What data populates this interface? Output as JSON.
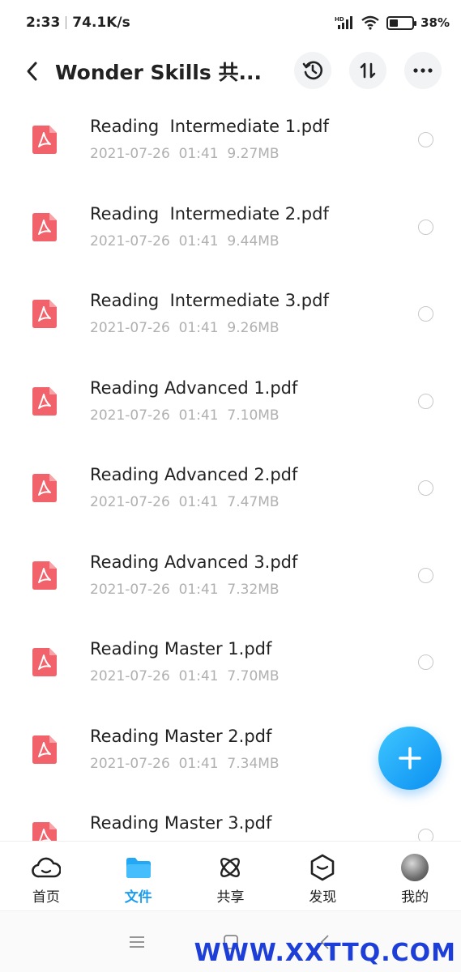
{
  "status_bar": {
    "time": "2:33",
    "net_speed": "74.1K/s",
    "battery_text": "38%",
    "battery_level": 0.38
  },
  "header": {
    "title": "Wonder Skills  共..."
  },
  "files": [
    {
      "name": "Reading  Intermediate 1.pdf",
      "meta": "2021-07-26  01:41  9.27MB"
    },
    {
      "name": "Reading  Intermediate 2.pdf",
      "meta": "2021-07-26  01:41  9.44MB"
    },
    {
      "name": "Reading  Intermediate 3.pdf",
      "meta": "2021-07-26  01:41  9.26MB"
    },
    {
      "name": "Reading Advanced 1.pdf",
      "meta": "2021-07-26  01:41  7.10MB"
    },
    {
      "name": "Reading Advanced 2.pdf",
      "meta": "2021-07-26  01:41  7.47MB"
    },
    {
      "name": "Reading Advanced 3.pdf",
      "meta": "2021-07-26  01:41  7.32MB"
    },
    {
      "name": "Reading Master 1.pdf",
      "meta": "2021-07-26  01:41  7.70MB"
    },
    {
      "name": "Reading Master 2.pdf",
      "meta": "2021-07-26  01:41  7.34MB"
    },
    {
      "name": "Reading Master 3.pdf",
      "meta": ""
    }
  ],
  "bottom_nav": {
    "items": [
      {
        "label": "首页",
        "icon": "cloud-icon"
      },
      {
        "label": "文件",
        "icon": "folder-icon"
      },
      {
        "label": "共享",
        "icon": "atom-icon"
      },
      {
        "label": "发现",
        "icon": "discover-icon"
      },
      {
        "label": "我的",
        "icon": "avatar"
      }
    ],
    "active_index": 1
  },
  "watermark": "WWW.XXTTQ.COM",
  "colors": {
    "accent": "#1a9cf0",
    "pdf_red": "#f2626b",
    "meta_gray": "#b0b0b0"
  }
}
